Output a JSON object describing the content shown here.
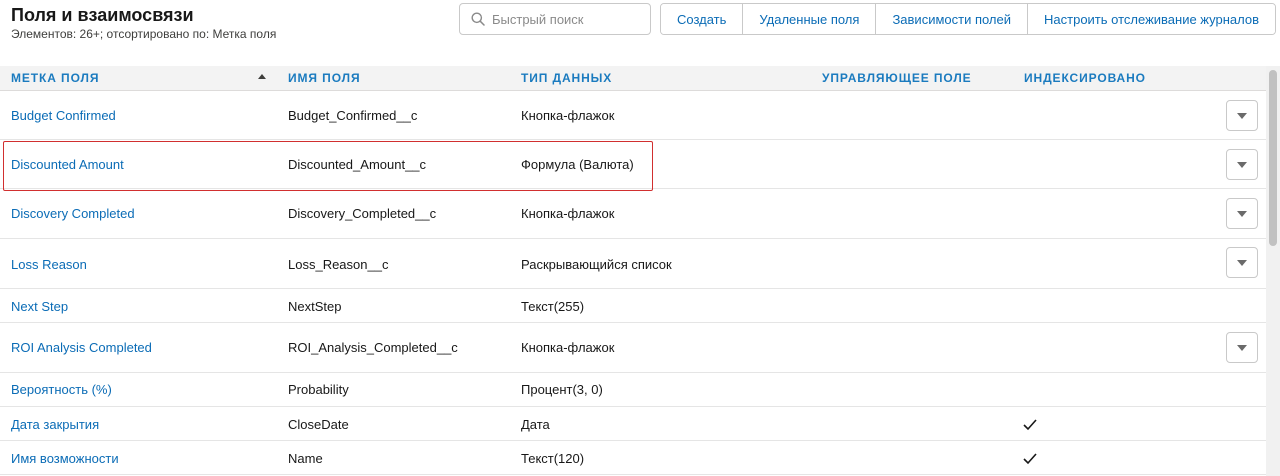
{
  "header": {
    "title": "Поля и взаимосвязи",
    "subtitle": "Элементов: 26+; отсортировано по: Метка поля"
  },
  "search": {
    "placeholder": "Быстрый поиск",
    "icon": "search-icon"
  },
  "toolbar": {
    "buttons": [
      "Создать",
      "Удаленные поля",
      "Зависимости полей",
      "Настроить отслеживание журналов"
    ]
  },
  "table": {
    "columns": [
      "МЕТКА ПОЛЯ",
      "ИМЯ ПОЛЯ",
      "ТИП ДАННЫХ",
      "УПРАВЛЯЮЩЕЕ ПОЛЕ",
      "ИНДЕКСИРОВАНО"
    ],
    "sort": {
      "column": "МЕТКА ПОЛЯ",
      "direction": "ascending"
    },
    "rows": [
      {
        "label": "Budget Confirmed",
        "api": "Budget_Confirmed__c",
        "type": "Кнопка-флажок",
        "controlling": "",
        "indexed": false,
        "menu": true
      },
      {
        "label": "Discounted Amount",
        "api": "Discounted_Amount__c",
        "type": "Формула (Валюта)",
        "controlling": "",
        "indexed": false,
        "menu": true,
        "highlighted": true
      },
      {
        "label": "Discovery Completed",
        "api": "Discovery_Completed__c",
        "type": "Кнопка-флажок",
        "controlling": "",
        "indexed": false,
        "menu": true
      },
      {
        "label": "Loss Reason",
        "api": "Loss_Reason__c",
        "type": "Раскрывающийся список",
        "controlling": "",
        "indexed": false,
        "menu": true
      },
      {
        "label": "Next Step",
        "api": "NextStep",
        "type": "Текст(255)",
        "controlling": "",
        "indexed": false,
        "menu": false
      },
      {
        "label": "ROI Analysis Completed",
        "api": "ROI_Analysis_Completed__c",
        "type": "Кнопка-флажок",
        "controlling": "",
        "indexed": false,
        "menu": true
      },
      {
        "label": "Вероятность (%)",
        "api": "Probability",
        "type": "Процент(3, 0)",
        "controlling": "",
        "indexed": false,
        "menu": false
      },
      {
        "label": "Дата закрытия",
        "api": "CloseDate",
        "type": "Дата",
        "controlling": "",
        "indexed": true,
        "menu": false
      },
      {
        "label": "Имя возможности",
        "api": "Name",
        "type": "Текст(120)",
        "controlling": "",
        "indexed": true,
        "menu": false
      }
    ]
  },
  "colors": {
    "link": "#0b6cb6",
    "header_text": "#1b7bbf",
    "highlight": "#d12f2f"
  }
}
